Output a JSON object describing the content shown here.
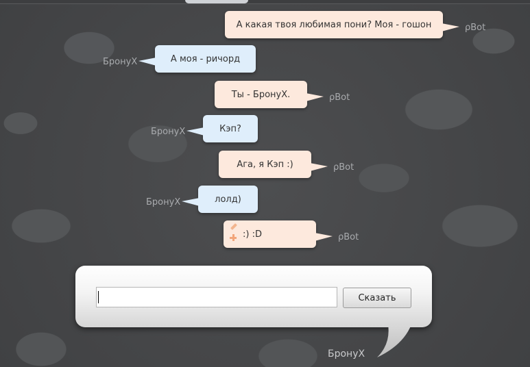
{
  "messages": [
    {
      "from": "bot",
      "text": "А какая твоя любимая пони? Моя - гошон",
      "author": "ρBot"
    },
    {
      "from": "user",
      "text": "А моя - ричорд",
      "author": "БронуХ"
    },
    {
      "from": "bot",
      "text": "Ты - БронуХ.",
      "author": "ρBot"
    },
    {
      "from": "user",
      "text": "Кэп?",
      "author": "БронуХ"
    },
    {
      "from": "bot",
      "text": "Ага, я Кэп :)",
      "author": "ρBot"
    },
    {
      "from": "user",
      "text": "лолд)",
      "author": "БронуХ"
    },
    {
      "from": "bot",
      "text": ":) :D",
      "author": "ρBot",
      "icons": [
        "pencil-icon",
        "plus-icon"
      ]
    }
  ],
  "composer": {
    "input_value": "",
    "send_label": "Сказать",
    "author": "БронуХ"
  },
  "colors": {
    "background": "#4b4c4e",
    "bot_bubble": "#fde9dd",
    "user_bubble": "#dfeefb",
    "author_text": "#a9abae"
  }
}
